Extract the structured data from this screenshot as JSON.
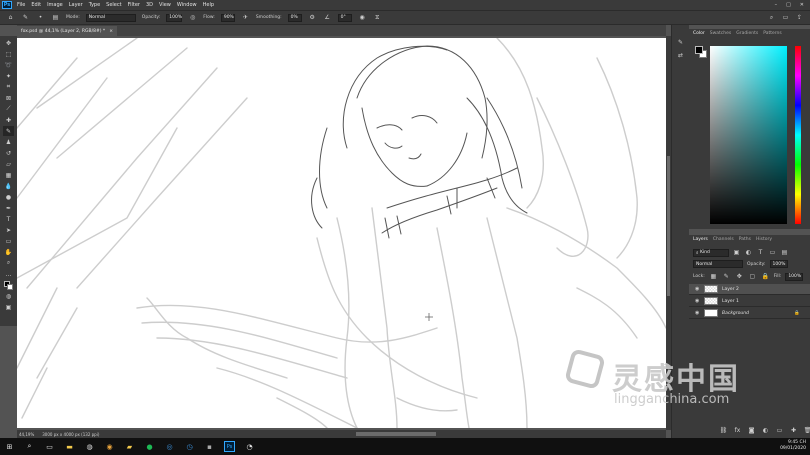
{
  "menubar": {
    "logo": "Ps",
    "items": [
      "File",
      "Edit",
      "Image",
      "Layer",
      "Type",
      "Select",
      "Filter",
      "3D",
      "View",
      "Window",
      "Help"
    ]
  },
  "options": {
    "mode_label": "Mode:",
    "mode_value": "Normal",
    "opacity_label": "Opacity:",
    "opacity_value": "100%",
    "flow_label": "Flow:",
    "flow_value": "90%",
    "smoothing_label": "Smoothing:",
    "smoothing_value": "0%",
    "angle_value": "0°"
  },
  "document": {
    "tab_title": "fox.psd @ 44,1% (Layer 2, RGB/8#) *",
    "close_glyph": "×"
  },
  "status": {
    "zoom": "44,19%",
    "doc_info": "3000 px x 4000 px (132 ppi)"
  },
  "color_panel": {
    "tabs": [
      "Color",
      "Swatches",
      "Gradients",
      "Patterns"
    ],
    "active_tab": "Color"
  },
  "layers_panel": {
    "tabs": [
      "Layers",
      "Channels",
      "Paths",
      "History"
    ],
    "active_tab": "Layers",
    "kind_label": "Kind",
    "blend_mode": "Normal",
    "opacity_label": "Opacity:",
    "opacity_value": "100%",
    "lock_label": "Lock:",
    "fill_label": "Fill:",
    "fill_value": "100%",
    "layers": [
      {
        "name": "Layer 2",
        "selected": true
      },
      {
        "name": "Layer 1",
        "selected": false
      },
      {
        "name": "Background",
        "selected": false
      }
    ]
  },
  "taskbar": {
    "time": "9:45 CH",
    "date": "09/01/2020"
  },
  "watermark": {
    "cn": "灵感中国",
    "en": "lingganchina.com"
  }
}
